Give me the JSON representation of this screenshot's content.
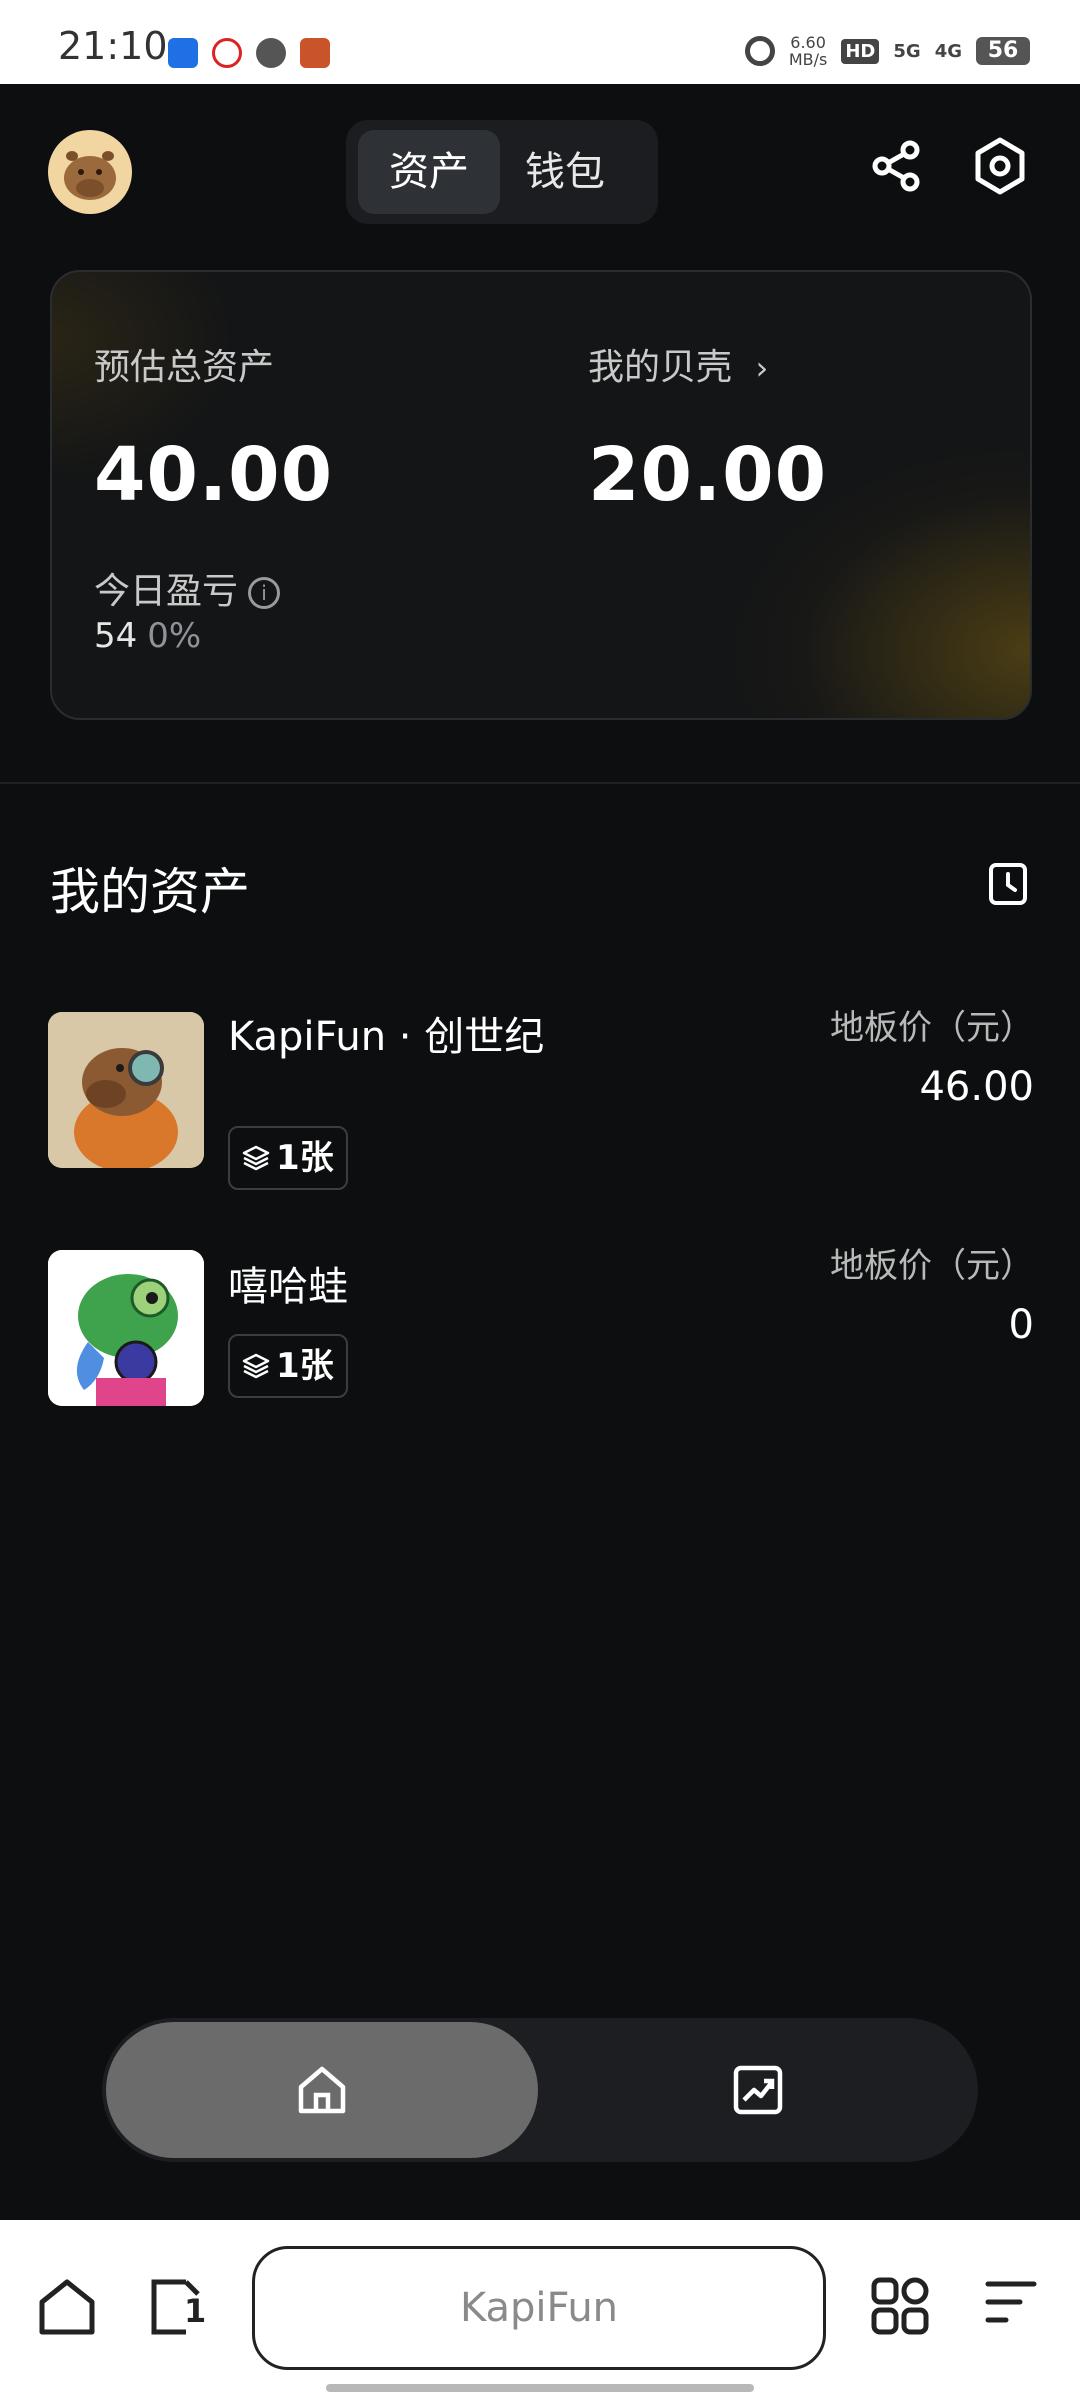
{
  "status_bar": {
    "time": "21:10",
    "net_speed_value": "6.60",
    "net_speed_unit": "MB/s",
    "hd": "HD",
    "signal_5g": "5G",
    "signal_4g": "4G",
    "battery": "56"
  },
  "header": {
    "tabs": [
      {
        "label": "资产",
        "active": true
      },
      {
        "label": "钱包",
        "active": false
      }
    ],
    "share_icon": "share-icon",
    "settings_icon": "gear-icon"
  },
  "summary": {
    "total_label": "预估总资产",
    "total_value": "40.00",
    "shells_label": "我的贝壳",
    "shells_value": "20.00",
    "pnl_label": "今日盈亏",
    "pnl_value": "54",
    "pnl_percent": "0%"
  },
  "assets_section": {
    "title": "我的资产",
    "items": [
      {
        "name": "KapiFun · 创世纪",
        "count": "1张",
        "floor_label": "地板价（元）",
        "floor_value": "46.00"
      },
      {
        "name": "嘻哈蛙",
        "count": "1张",
        "floor_label": "地板价（元）",
        "floor_value": "0"
      }
    ]
  },
  "tabbar": {
    "items": [
      {
        "icon": "home-icon",
        "active": true
      },
      {
        "icon": "trend-chart-icon",
        "active": false
      }
    ]
  },
  "browser": {
    "url_text": "KapiFun",
    "tab_count": "1"
  },
  "colors": {
    "background": "#0d0e0f",
    "card_glow": "#785f14",
    "tab_active": "#6b6b6b"
  }
}
